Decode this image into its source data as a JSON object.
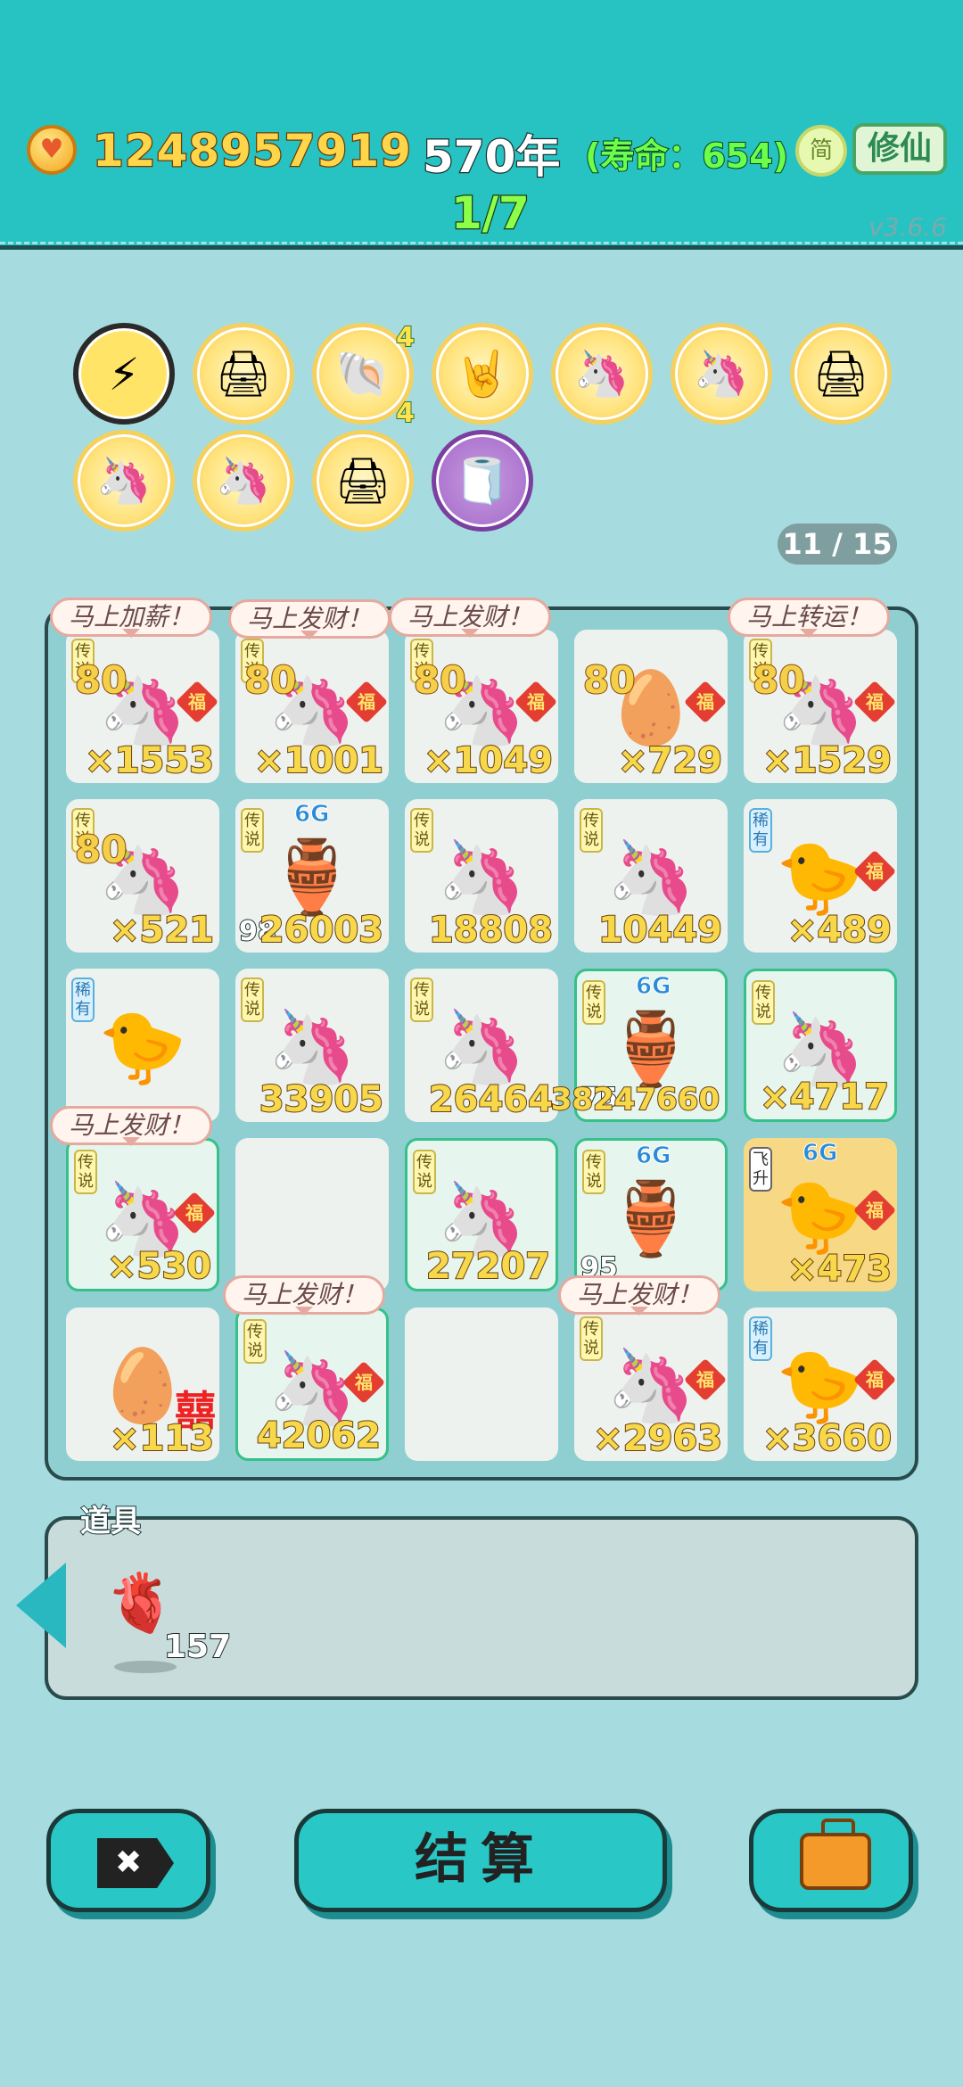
{
  "header": {
    "money": "1248957919",
    "year": "570年",
    "lifespan": "(寿命：654)",
    "round": "1/7",
    "lang_label": "简",
    "cultivate_label": "修仙",
    "version": "v3.6.6"
  },
  "buffs": [
    {
      "icon": "lightning-icon",
      "glyph": "⚡"
    },
    {
      "icon": "printer-icon",
      "glyph": "🖨"
    },
    {
      "icon": "shell-icon",
      "glyph": "🐚",
      "top": "4",
      "bottom": "4"
    },
    {
      "icon": "rock-hand-icon",
      "glyph": "🤘"
    },
    {
      "icon": "unicorn-icon",
      "glyph": "🦄"
    },
    {
      "icon": "unicorn-icon",
      "glyph": "🦄"
    },
    {
      "icon": "printer-icon",
      "glyph": "🖨"
    },
    {
      "icon": "unicorn-icon",
      "glyph": "🦄"
    },
    {
      "icon": "unicorn-icon",
      "glyph": "🦄"
    },
    {
      "icon": "printer-icon",
      "glyph": "🖨"
    },
    {
      "icon": "tissue-box-icon",
      "glyph": "🧻"
    }
  ],
  "pager": "11 / 15",
  "bubbles": [
    "马上加薪！",
    "马上发财！",
    "马上发财！",
    "马上转运！",
    "马上发财！",
    "马上发财！",
    "马上发财！"
  ],
  "grid": [
    {
      "tag": "传说",
      "item": "🦄",
      "bonus": "80",
      "fu": "福",
      "count": "×1553"
    },
    {
      "tag": "传说",
      "item": "🦄",
      "bonus": "80",
      "fu": "福",
      "count": "×1001"
    },
    {
      "tag": "传说",
      "item": "🦄",
      "bonus": "80",
      "fu": "福",
      "count": "×1049"
    },
    {
      "tag": "",
      "item": "🥚",
      "bonus": "80",
      "fu": "福",
      "count": "×729"
    },
    {
      "tag": "传说",
      "item": "🦄",
      "bonus": "80",
      "fu": "福",
      "count": "×1529"
    },
    {
      "tag": "传说",
      "item": "🦄",
      "bonus": "80",
      "count": "×521"
    },
    {
      "tag": "传说",
      "item": "🏺",
      "g": "6G",
      "left": "98",
      "count": "26003"
    },
    {
      "tag": "传说",
      "item": "🦄",
      "count": "18808"
    },
    {
      "tag": "传说",
      "item": "🦄",
      "count": "10449"
    },
    {
      "tag": "稀有",
      "item": "🐤",
      "fu": "福",
      "count": "×489"
    },
    {
      "tag": "稀有",
      "item": "🐤",
      "count": ""
    },
    {
      "tag": "传说",
      "item": "🦄",
      "count": "33905"
    },
    {
      "tag": "传说",
      "item": "🦄",
      "count": "26464"
    },
    {
      "tag": "传说",
      "item": "🏺",
      "g": "6G",
      "left": "75",
      "count": "38247660"
    },
    {
      "tag": "传说",
      "item": "🦄",
      "count": "×4717"
    },
    {
      "tag": "传说",
      "item": "🦄",
      "fu": "福",
      "count": "×530"
    },
    {
      "tag": "",
      "item": "",
      "count": ""
    },
    {
      "tag": "传说",
      "item": "🦄",
      "count": "27207"
    },
    {
      "tag": "传说",
      "item": "🏺",
      "g": "6G",
      "left": "95",
      "count": ""
    },
    {
      "tag": "飞升",
      "item": "🐤",
      "g": "6G",
      "fu": "福",
      "count": "×473"
    },
    {
      "tag": "",
      "item": "🥚",
      "xi": "囍",
      "count": "×113"
    },
    {
      "tag": "传说",
      "item": "🦄",
      "fu": "福",
      "count": "42062"
    },
    {
      "tag": "",
      "item": "",
      "count": ""
    },
    {
      "tag": "传说",
      "item": "🦄",
      "fu": "福",
      "count": "×2963"
    },
    {
      "tag": "稀有",
      "item": "🐤",
      "fu": "福",
      "count": "×3660"
    }
  ],
  "props": {
    "title": "道具",
    "items": [
      {
        "icon": "liver-icon",
        "glyph": "🫀",
        "count": "157"
      }
    ]
  },
  "buttons": {
    "settle": "结算",
    "cancel_icon": "close-icon",
    "bag_icon": "briefcase-icon"
  },
  "colors": {
    "accent": "#26c3c2",
    "background": "#a6dcdf",
    "coin": "#ffd54a"
  }
}
